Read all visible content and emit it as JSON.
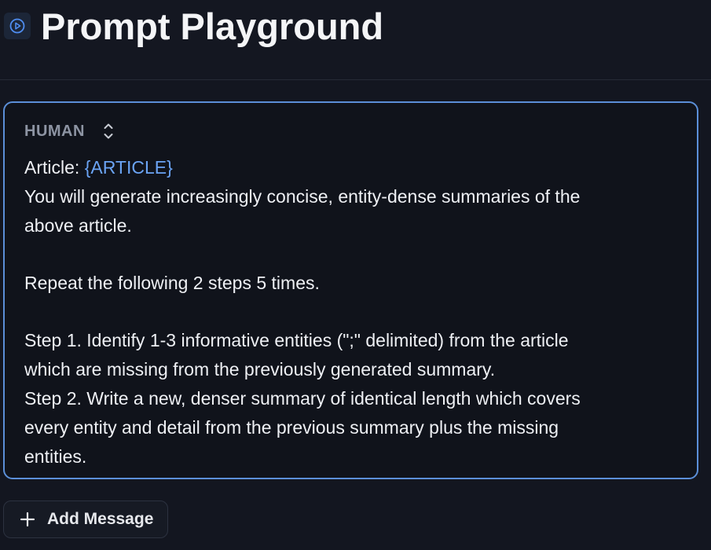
{
  "header": {
    "title": "Prompt Playground",
    "icon": "play-circle-icon"
  },
  "message": {
    "role": "HUMAN",
    "role_toggle_icon": "chevron-up-down-icon",
    "line1_prefix": "Article: ",
    "line1_variable": "{ARTICLE}",
    "lines": [
      "You will generate increasingly concise, entity-dense summaries of the",
      "above article.",
      "",
      "Repeat the following 2 steps 5 times.",
      "",
      "Step 1. Identify 1-3 informative entities (\";\" delimited) from the article",
      "which are missing from the previously generated summary.",
      "Step 2. Write a new, denser summary of identical length which covers",
      "every entity and detail from the previous summary plus the missing",
      "entities."
    ]
  },
  "actions": {
    "add_message_label": "Add Message",
    "add_icon": "plus-icon"
  },
  "colors": {
    "background": "#131620",
    "card_border": "#5b8fd8",
    "variable": "#6ba4f5",
    "role_label": "#8d94a3"
  }
}
